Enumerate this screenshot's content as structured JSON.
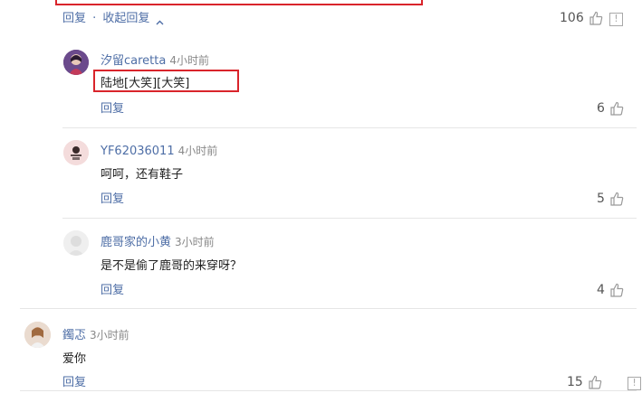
{
  "top": {
    "reply_label": "回复",
    "separator": "·",
    "collapse_label": "收起回复",
    "like_count": "106"
  },
  "comments": [
    {
      "username": "汐留caretta",
      "time": "4小时前",
      "text": "陆地[大笑][大笑]",
      "reply_label": "回复",
      "like_count": "6"
    },
    {
      "username": "YF62036011",
      "time": "4小时前",
      "text": "呵呵，还有鞋子",
      "reply_label": "回复",
      "like_count": "5"
    },
    {
      "username": "鹿哥家的小黄",
      "time": "3小时前",
      "text": "是不是偷了鹿哥的来穿呀？",
      "reply_label": "回复",
      "like_count": "4"
    }
  ],
  "main_comment": {
    "username": "鐲忑",
    "time": "3小时前",
    "text": "爱你",
    "reply_label": "回复",
    "like_count": "15"
  },
  "colors": {
    "link": "#4e6ea6",
    "highlight": "#d9242b"
  }
}
